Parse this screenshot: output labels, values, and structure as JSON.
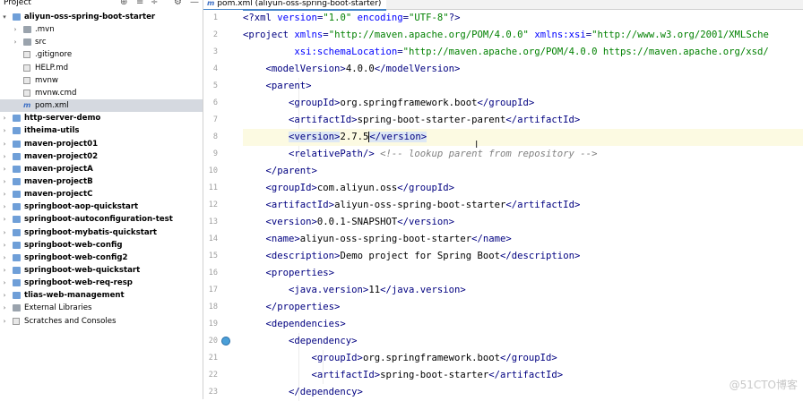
{
  "project_panel": {
    "title": "Project",
    "controls": [
      "⊕",
      "≡",
      "÷",
      "⚙",
      "—"
    ],
    "tree": [
      {
        "label": "aliyun-oss-spring-boot-starter",
        "depth": 0,
        "expanded": true,
        "kind": "module",
        "bold": true
      },
      {
        "label": ".mvn",
        "depth": 1,
        "expanded": false,
        "kind": "folder"
      },
      {
        "label": "src",
        "depth": 1,
        "expanded": false,
        "kind": "folder"
      },
      {
        "label": ".gitignore",
        "depth": 1,
        "kind": "file"
      },
      {
        "label": "HELP.md",
        "depth": 1,
        "kind": "file"
      },
      {
        "label": "mvnw",
        "depth": 1,
        "kind": "file"
      },
      {
        "label": "mvnw.cmd",
        "depth": 1,
        "kind": "file"
      },
      {
        "label": "pom.xml",
        "depth": 1,
        "kind": "maven",
        "selected": true
      },
      {
        "label": "http-server-demo",
        "depth": 0,
        "expanded": false,
        "kind": "module",
        "bold": true
      },
      {
        "label": "itheima-utils",
        "depth": 0,
        "expanded": false,
        "kind": "module",
        "bold": true
      },
      {
        "label": "maven-project01",
        "depth": 0,
        "expanded": false,
        "kind": "module",
        "bold": true
      },
      {
        "label": "maven-project02",
        "depth": 0,
        "expanded": false,
        "kind": "module",
        "bold": true
      },
      {
        "label": "maven-projectA",
        "depth": 0,
        "expanded": false,
        "kind": "module",
        "bold": true
      },
      {
        "label": "maven-projectB",
        "depth": 0,
        "expanded": false,
        "kind": "module",
        "bold": true
      },
      {
        "label": "maven-projectC",
        "depth": 0,
        "expanded": false,
        "kind": "module",
        "bold": true
      },
      {
        "label": "springboot-aop-quickstart",
        "depth": 0,
        "expanded": false,
        "kind": "module",
        "bold": true
      },
      {
        "label": "springboot-autoconfiguration-test",
        "depth": 0,
        "expanded": false,
        "kind": "module",
        "bold": true
      },
      {
        "label": "springboot-mybatis-quickstart",
        "depth": 0,
        "expanded": false,
        "kind": "module",
        "bold": true
      },
      {
        "label": "springboot-web-config",
        "depth": 0,
        "expanded": false,
        "kind": "module",
        "bold": true
      },
      {
        "label": "springboot-web-config2",
        "depth": 0,
        "expanded": false,
        "kind": "module",
        "bold": true
      },
      {
        "label": "springboot-web-quickstart",
        "depth": 0,
        "expanded": false,
        "kind": "module",
        "bold": true
      },
      {
        "label": "springboot-web-req-resp",
        "depth": 0,
        "expanded": false,
        "kind": "module",
        "bold": true
      },
      {
        "label": "tlias-web-management",
        "depth": 0,
        "expanded": false,
        "kind": "module",
        "bold": true
      },
      {
        "label": "External Libraries",
        "depth": 0,
        "expanded": false,
        "kind": "library"
      },
      {
        "label": "Scratches and Consoles",
        "depth": 0,
        "expanded": false,
        "kind": "scratch"
      }
    ]
  },
  "editor": {
    "tab_label": "pom.xml (aliyun-oss-spring-boot-starter)",
    "line_numbers": [
      "1",
      "2",
      "3",
      "4",
      "5",
      "6",
      "7",
      "8",
      "9",
      "10",
      "11",
      "12",
      "13",
      "14",
      "15",
      "16",
      "17",
      "18",
      "19",
      "20",
      "21",
      "22",
      "23"
    ],
    "highlight_line": 8,
    "run_icon_line": 20,
    "lines": [
      [
        [
          "tag",
          "<?xml "
        ],
        [
          "attr",
          "version"
        ],
        [
          "tag",
          "="
        ],
        [
          "val",
          "\"1.0\""
        ],
        [
          "tag",
          " "
        ],
        [
          "attr",
          "encoding"
        ],
        [
          "tag",
          "="
        ],
        [
          "val",
          "\"UTF-8\""
        ],
        [
          "tag",
          "?>"
        ]
      ],
      [
        [
          "tag",
          "<project "
        ],
        [
          "attr",
          "xmlns"
        ],
        [
          "tag",
          "="
        ],
        [
          "val",
          "\"http://maven.apache.org/POM/4.0.0\""
        ],
        [
          "tag",
          " "
        ],
        [
          "attr",
          "xmlns:xsi"
        ],
        [
          "tag",
          "="
        ],
        [
          "val",
          "\"http://www.w3.org/2001/XMLSche"
        ]
      ],
      [
        [
          "tag",
          "         "
        ],
        [
          "attr",
          "xsi:schemaLocation"
        ],
        [
          "tag",
          "="
        ],
        [
          "val",
          "\"http://maven.apache.org/POM/4.0.0 https://maven.apache.org/xsd/"
        ]
      ],
      [
        [
          "tag",
          "    <modelVersion>"
        ],
        [
          "text",
          "4.0.0"
        ],
        [
          "tag",
          "</modelVersion>"
        ]
      ],
      [
        [
          "tag",
          "    <parent>"
        ]
      ],
      [
        [
          "tag",
          "        <groupId>"
        ],
        [
          "text",
          "org.springframework.boot"
        ],
        [
          "tag",
          "</groupId>"
        ]
      ],
      [
        [
          "tag",
          "        <artifactId>"
        ],
        [
          "text",
          "spring-boot-starter-parent"
        ],
        [
          "tag",
          "</artifactId>"
        ]
      ],
      [
        [
          "tag",
          "        "
        ],
        [
          "box",
          "<version>"
        ],
        [
          "text",
          "2.7.5"
        ],
        [
          "caret",
          ""
        ],
        [
          "box",
          "</version>"
        ]
      ],
      [
        [
          "tag",
          "        <relativePath/> "
        ],
        [
          "comment",
          "<!-- lookup parent from repository -->"
        ]
      ],
      [
        [
          "tag",
          "    </parent>"
        ]
      ],
      [
        [
          "tag",
          "    <groupId>"
        ],
        [
          "text",
          "com.aliyun.oss"
        ],
        [
          "tag",
          "</groupId>"
        ]
      ],
      [
        [
          "tag",
          "    <artifactId>"
        ],
        [
          "text",
          "aliyun-oss-spring-boot-starter"
        ],
        [
          "tag",
          "</artifactId>"
        ]
      ],
      [
        [
          "tag",
          "    <version>"
        ],
        [
          "text",
          "0.0.1-SNAPSHOT"
        ],
        [
          "tag",
          "</version>"
        ]
      ],
      [
        [
          "tag",
          "    <name>"
        ],
        [
          "text",
          "aliyun-oss-spring-boot-starter"
        ],
        [
          "tag",
          "</name>"
        ]
      ],
      [
        [
          "tag",
          "    <description>"
        ],
        [
          "text",
          "Demo project for Spring Boot"
        ],
        [
          "tag",
          "</description>"
        ]
      ],
      [
        [
          "tag",
          "    <properties>"
        ]
      ],
      [
        [
          "tag",
          "        <java.version>"
        ],
        [
          "text",
          "11"
        ],
        [
          "tag",
          "</java.version>"
        ]
      ],
      [
        [
          "tag",
          "    </properties>"
        ]
      ],
      [
        [
          "tag",
          "    <dependencies>"
        ]
      ],
      [
        [
          "tag",
          "        <dependency>"
        ]
      ],
      [
        [
          "tag",
          "            <groupId>"
        ],
        [
          "text",
          "org.springframework.boot"
        ],
        [
          "tag",
          "</groupId>"
        ]
      ],
      [
        [
          "tag",
          "            <artifactId>"
        ],
        [
          "text",
          "spring-boot-starter"
        ],
        [
          "tag",
          "</artifactId>"
        ]
      ],
      [
        [
          "tag",
          "        </dependency>"
        ]
      ]
    ]
  },
  "watermark": "@51CTO博客"
}
